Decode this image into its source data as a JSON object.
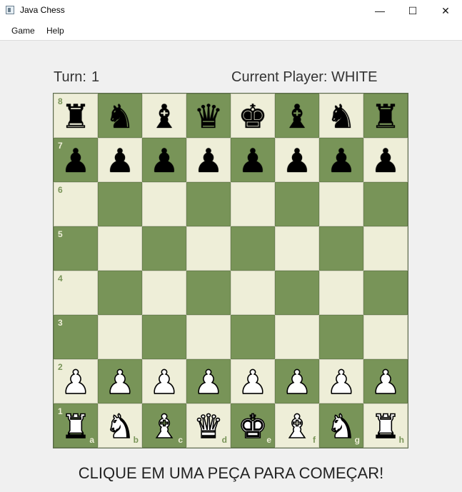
{
  "window": {
    "title": "Java Chess",
    "controls": {
      "minimize": "—",
      "maximize": "☐",
      "close": "✕"
    }
  },
  "menu": [
    {
      "label": "Game"
    },
    {
      "label": "Help"
    }
  ],
  "info": {
    "turn_label": "Turn:",
    "turn_value": "1",
    "player_label": "Current Player:",
    "player_value": "WHITE"
  },
  "board": {
    "light_color": "#eeeed8",
    "dark_color": "#789458",
    "files": [
      "a",
      "b",
      "c",
      "d",
      "e",
      "f",
      "g",
      "h"
    ],
    "ranks": [
      "8",
      "7",
      "6",
      "5",
      "4",
      "3",
      "2",
      "1"
    ],
    "position": [
      [
        "bR",
        "bN",
        "bB",
        "bQ",
        "bK",
        "bB",
        "bN",
        "bR"
      ],
      [
        "bP",
        "bP",
        "bP",
        "bP",
        "bP",
        "bP",
        "bP",
        "bP"
      ],
      [
        "",
        "",
        "",
        "",
        "",
        "",
        "",
        ""
      ],
      [
        "",
        "",
        "",
        "",
        "",
        "",
        "",
        ""
      ],
      [
        "",
        "",
        "",
        "",
        "",
        "",
        "",
        ""
      ],
      [
        "",
        "",
        "",
        "",
        "",
        "",
        "",
        ""
      ],
      [
        "wP",
        "wP",
        "wP",
        "wP",
        "wP",
        "wP",
        "wP",
        "wP"
      ],
      [
        "wR",
        "wN",
        "wB",
        "wQ",
        "wK",
        "wB",
        "wN",
        "wR"
      ]
    ]
  },
  "status": "CLIQUE EM UMA PEÇA PARA COMEÇAR!"
}
